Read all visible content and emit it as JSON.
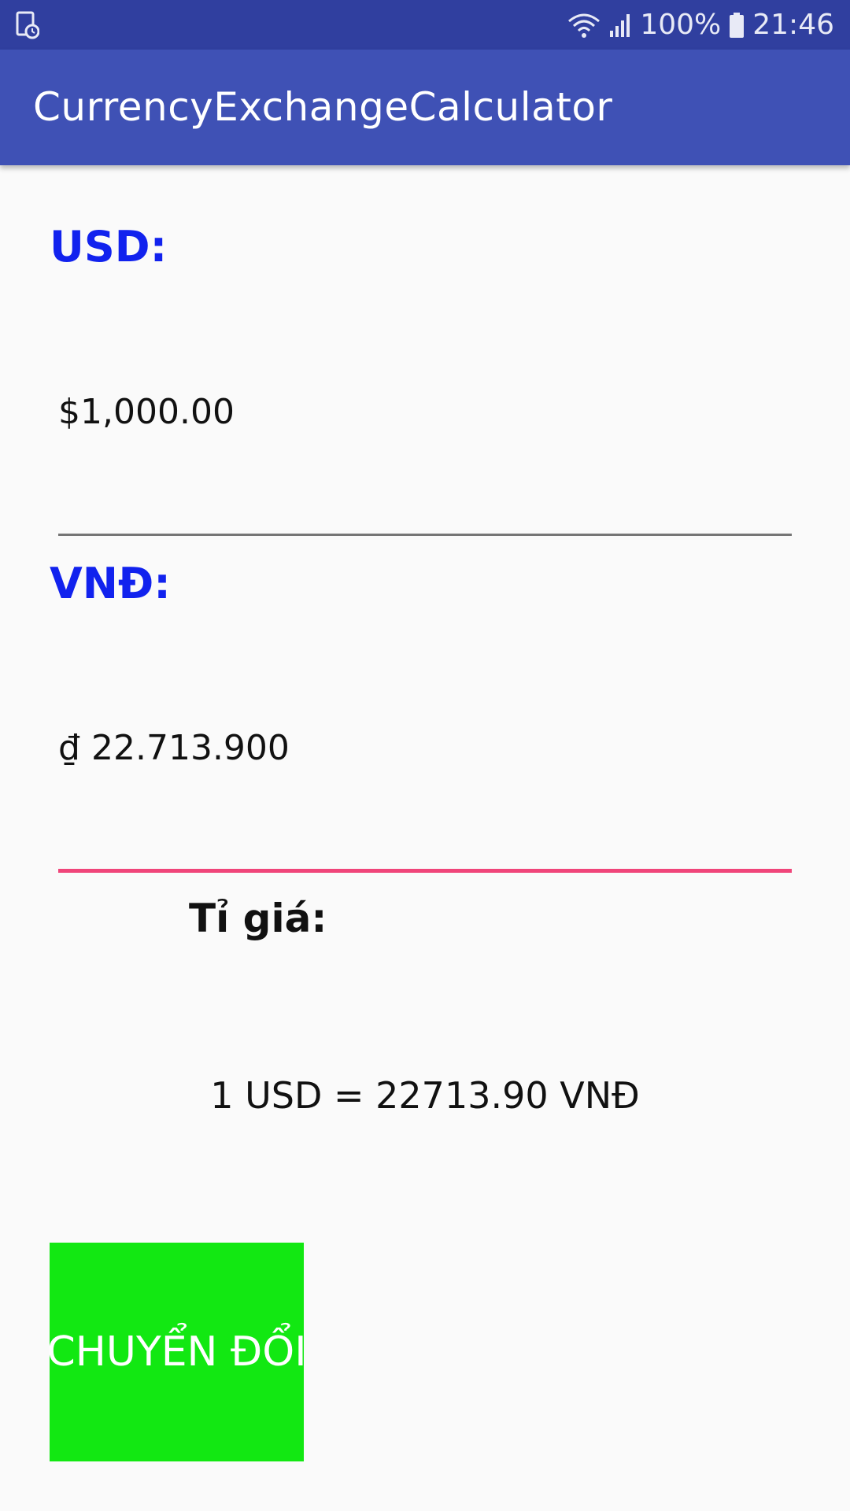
{
  "status_bar": {
    "battery": "100%",
    "time": "21:46",
    "icons": [
      "screenshot-icon",
      "wifi-icon",
      "signal-icon",
      "battery-icon"
    ]
  },
  "app_bar": {
    "title": "CurrencyExchangeCalculator"
  },
  "usd": {
    "label": "USD:",
    "value": "$1,000.00"
  },
  "vnd": {
    "label": "VNĐ:",
    "value": "₫ 22.713.900"
  },
  "rate": {
    "label": "Tỉ giá:",
    "value": "1 USD = 22713.90 VNĐ"
  },
  "convert_button": {
    "label": "CHUYỂN ĐỔI"
  },
  "colors": {
    "status_bar": "#303f9f",
    "app_bar": "#3f51b5",
    "label_blue": "#1122ee",
    "button_green": "#12e812",
    "focus_underline": "#f0457a",
    "underline_gray": "#757575"
  }
}
